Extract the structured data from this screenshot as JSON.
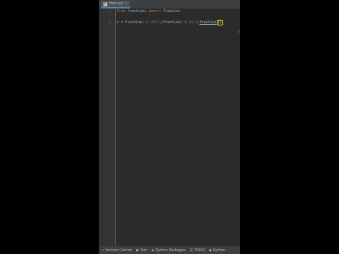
{
  "tab": {
    "file_name": "Main.py",
    "close_symbol": "×"
  },
  "gutter": {
    "line_1": "1",
    "line_3": "3"
  },
  "code": {
    "line_1": {
      "kw_from": "from",
      "module": " fractions ",
      "kw_import": "import",
      "name": " Fraction"
    },
    "line_3": {
      "lhs": "x = Fraction(",
      "str1": "'0.265'",
      "mid": ")/Fraction(",
      "str2": "'0.15'",
      "close": ")+",
      "fn": "Fraction",
      "paren": "()"
    }
  },
  "statusbar": {
    "items": [
      {
        "icon": "version-control-icon",
        "glyph": "⑂",
        "label": "Version Control"
      },
      {
        "icon": "run-icon",
        "glyph": "▶",
        "label": "Run"
      },
      {
        "icon": "python-packages-icon",
        "glyph": "◈",
        "label": "Python Packages"
      },
      {
        "icon": "todo-icon",
        "glyph": "☰",
        "label": "TODO"
      },
      {
        "icon": "python-console-icon",
        "glyph": "◆",
        "label": "Python"
      }
    ]
  },
  "colors": {
    "editor_bg": "#2b2b2b",
    "keyword": "#cc7832",
    "string": "#6a8759",
    "text": "#a9b7c6",
    "caret_highlight": "#ffef28"
  }
}
